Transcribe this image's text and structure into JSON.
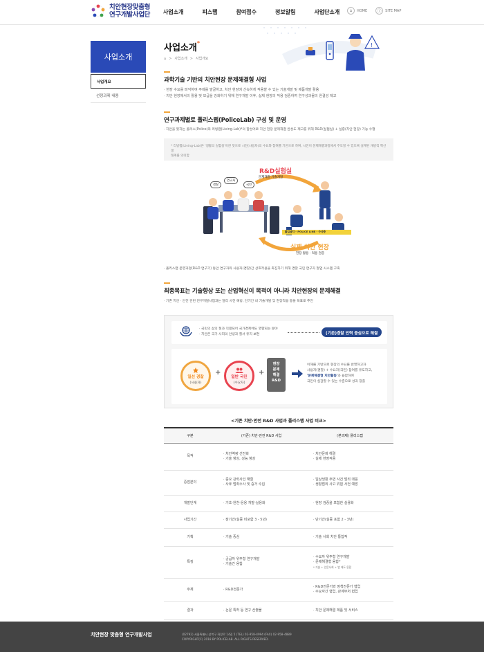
{
  "header": {
    "logo_line1": "치안현장맞춤형",
    "logo_line2": "연구개발사업단",
    "nav": [
      "사업소개",
      "피스랩",
      "참여접수",
      "정보알림",
      "사업단소개"
    ],
    "util": [
      {
        "icon": "home-icon",
        "label": "HOME"
      },
      {
        "icon": "sitemap-icon",
        "label": "SITE MAP"
      }
    ]
  },
  "sidebar": {
    "title": "사업소개",
    "items": [
      {
        "label": "사업개요",
        "active": true
      },
      {
        "label": "선정과제 내용",
        "active": false
      }
    ]
  },
  "page": {
    "title": "사업소개",
    "breadcrumb": [
      "사업소개",
      "사업개요"
    ]
  },
  "sections": {
    "s1": {
      "title": "과학기술 기반의 치안현장 문제해결형 사업",
      "lines": [
        "· 현장 수요를 파악하여 주제를 발굴하고, 치안 현장에 신속하게 적용할 수 있는 기술개발 및 제품개발 활용",
        "· 치안 현장에서의 활용 및 보급을 강화하기 위해 연구개발 이후, 실제 현장의 적용 검증하여 연구성과물의 완결성 제고"
      ]
    },
    "s2": {
      "title": "연구과제별로 폴리스랩(PoliceLab) 구성 및 운영",
      "lines": [
        "· 치안을 뜻하는 폴리스(Police)와 리빙랩(Living-Lab)*의 합성어로 치안 현장 문제해결 완성도 제고를 위해 R&D(실험실) + 실증(치안 현장) 기능 수행"
      ],
      "note": [
        "* 리빙랩(Living-Lab)은 '생활의 실험실'이란 뜻으로 시민(사용자)의 수요와 참여를 기반으로 하여, 시민이 문제해결과정에서 주도할 수 있도록 설계된 개방적 혁신 생",
        "  태계를 의미함"
      ],
      "diagram": {
        "lab_title": "R&D실험실",
        "lab_sub": "문제해결 기술개발",
        "field_title": "실제 치안 현장",
        "field_sub": "현장 활용 · 적용 검증",
        "bubbles": [
          "경찰",
          "연구자",
          "국민"
        ],
        "tape": "출입금지 - POLICE LINE - 수사중"
      },
      "after": "· 폴리스랩 운영과정(R&D 연구기) 동안 연구자와 사용자(경찰)간 상호작용을 촉진하기 위해 경찰 국민 연구자 협업 시스템 구축"
    },
    "s3": {
      "title": "최종목표는 기술향상 또는 산업혁신이 목적이 아니라 치안현장의 문제해결",
      "lines": [
        "· 기존 치안 · 안전 관련 연구개발사업과는 달리 사전 예방, 단기간 내 기술개발 및 현장적용 등을 목표로 추진"
      ]
    }
  },
  "panel": {
    "top_lines": [
      "· 국민의 삶의 질과 직결되어 국가경제에도 영향되는 분야",
      "· 치안은 국가 사회의 안녕과 질서 유지 보편"
    ],
    "pill": "(기존)경찰 인력 중심으로 해결",
    "circle1": {
      "title": "일선 경찰",
      "sub": "(사용자)"
    },
    "circle2": {
      "title": "일반 국민",
      "sub": "(수요자)"
    },
    "rnd_box": [
      "현장",
      "문제",
      "해결",
      "R&D"
    ],
    "result_lines": [
      "이해를 기반으로 현장의 수요를 반영하고자",
      "사용자(경찰) + 수요자(국민) 참여를 유도하고,"
    ],
    "result_hl": "'문제해결형 치안활동'",
    "result_tail": "과 융합하여",
    "result_last": "국민이 실감할 수 있는 수준으로 성과 창출"
  },
  "table": {
    "title": "<기존 치안·안전 R&D 사업과 폴리스랩 사업 비교>",
    "headers": [
      "구분",
      "(기존) 치안·안전 R&D 사업",
      "(본과제) 폴리스랩"
    ],
    "rows": [
      {
        "k": "목적",
        "a": [
          "· 치안역량 선진화",
          "· 기술 향상, 성능 향상"
        ],
        "b": [
          "· 치안문제 해결",
          "· 실제 현장적용"
        ]
      },
      {
        "k": "중점분야",
        "a": [
          "· 중요 강력사건 해결",
          "· 사후 범죄수사 및 증거 수집"
        ],
        "b": [
          "· 일상생활 주변 사건 범죄 대응",
          "· 생활범죄 사고 위험 사전 예방"
        ]
      },
      {
        "k": "개발단계",
        "a": [
          "· 기초·원천-응용 개발-실용화"
        ],
        "b": [
          "· 현장 검증을 포함한 실용화"
        ]
      },
      {
        "k": "사업기간",
        "a": [
          "· 장기간(실증 미포함 3 - 5년)"
        ],
        "b": [
          "· 단기간(실증 포함 2 - 3년)"
        ]
      },
      {
        "k": "기획",
        "a": [
          "· 기술 중심"
        ],
        "b": [
          "· 기술 사회 치안 통합적"
        ]
      },
      {
        "k": "특징",
        "a": [
          "· 공급자 위주형 연구개발",
          "· 기술간 융합"
        ],
        "b": [
          "· 수요자 위주형 연구개발",
          "· 문제해결형 융합*"
        ],
        "b_small": "* 기술 + 인문사회 + 법 제도 융합"
      },
      {
        "k": "주체",
        "a": [
          "· R&D전문가"
        ],
        "b": [
          "· R&D전문가와 정책전문가 협업",
          "· 수요자간 협업, 관계부처 협업"
        ]
      },
      {
        "k": "결과",
        "a": [
          "· 논문 특허 등 연구 산출물"
        ],
        "b": [
          "· 치안 문제해결 제품 및 서비스"
        ]
      }
    ]
  },
  "footer": {
    "logo": "치안현장 맞춤형 연구개발사업",
    "line1": "(02792) 서울특별시 성북구 화랑로 14길 5 (TEL) 02-958-4994 (FAX) 02-958-4889",
    "line2": "COPYRIGHT(C) 2018 BY POLICELAB. ALL RIGHTS RESERVED."
  },
  "colors": {
    "brand": "#2a4ab7",
    "accent": "#f2a53b",
    "navy": "#24468d",
    "red": "#e8434f"
  }
}
